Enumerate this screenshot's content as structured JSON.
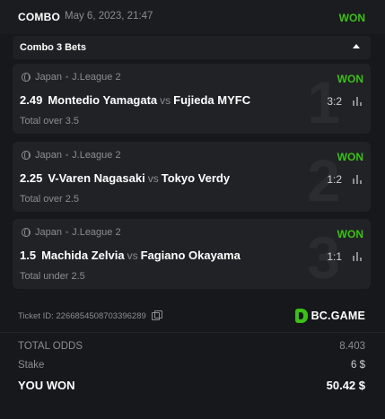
{
  "header": {
    "combo_label": "COMBO",
    "datetime": "May 6, 2023, 21:47",
    "status": "WON"
  },
  "combo_section": {
    "label": "Combo 3 Bets"
  },
  "bets": [
    {
      "index": "1",
      "country": "Japan",
      "league": "J.League 2",
      "status": "WON",
      "odds": "2.49",
      "home": "Montedio Yamagata",
      "vs": "vs",
      "away": "Fujieda MYFC",
      "score": "3:2",
      "market": "Total over 3.5"
    },
    {
      "index": "2",
      "country": "Japan",
      "league": "J.League 2",
      "status": "WON",
      "odds": "2.25",
      "home": "V-Varen Nagasaki",
      "vs": "vs",
      "away": "Tokyo Verdy",
      "score": "1:2",
      "market": "Total over 2.5"
    },
    {
      "index": "3",
      "country": "Japan",
      "league": "J.League 2",
      "status": "WON",
      "odds": "1.5",
      "home": "Machida Zelvia",
      "vs": "vs",
      "away": "Fagiano Okayama",
      "score": "1:1",
      "market": "Total under 2.5"
    }
  ],
  "ticket": {
    "id_text": "Ticket ID: 2266854508703396289"
  },
  "brand": {
    "name": "BC.GAME",
    "color": "#3bc117"
  },
  "summary": {
    "total_odds_label": "TOTAL ODDS",
    "total_odds_value": "8.403",
    "stake_label": "Stake",
    "stake_value": "6 $",
    "won_label": "YOU WON",
    "won_value": "50.42 $"
  }
}
